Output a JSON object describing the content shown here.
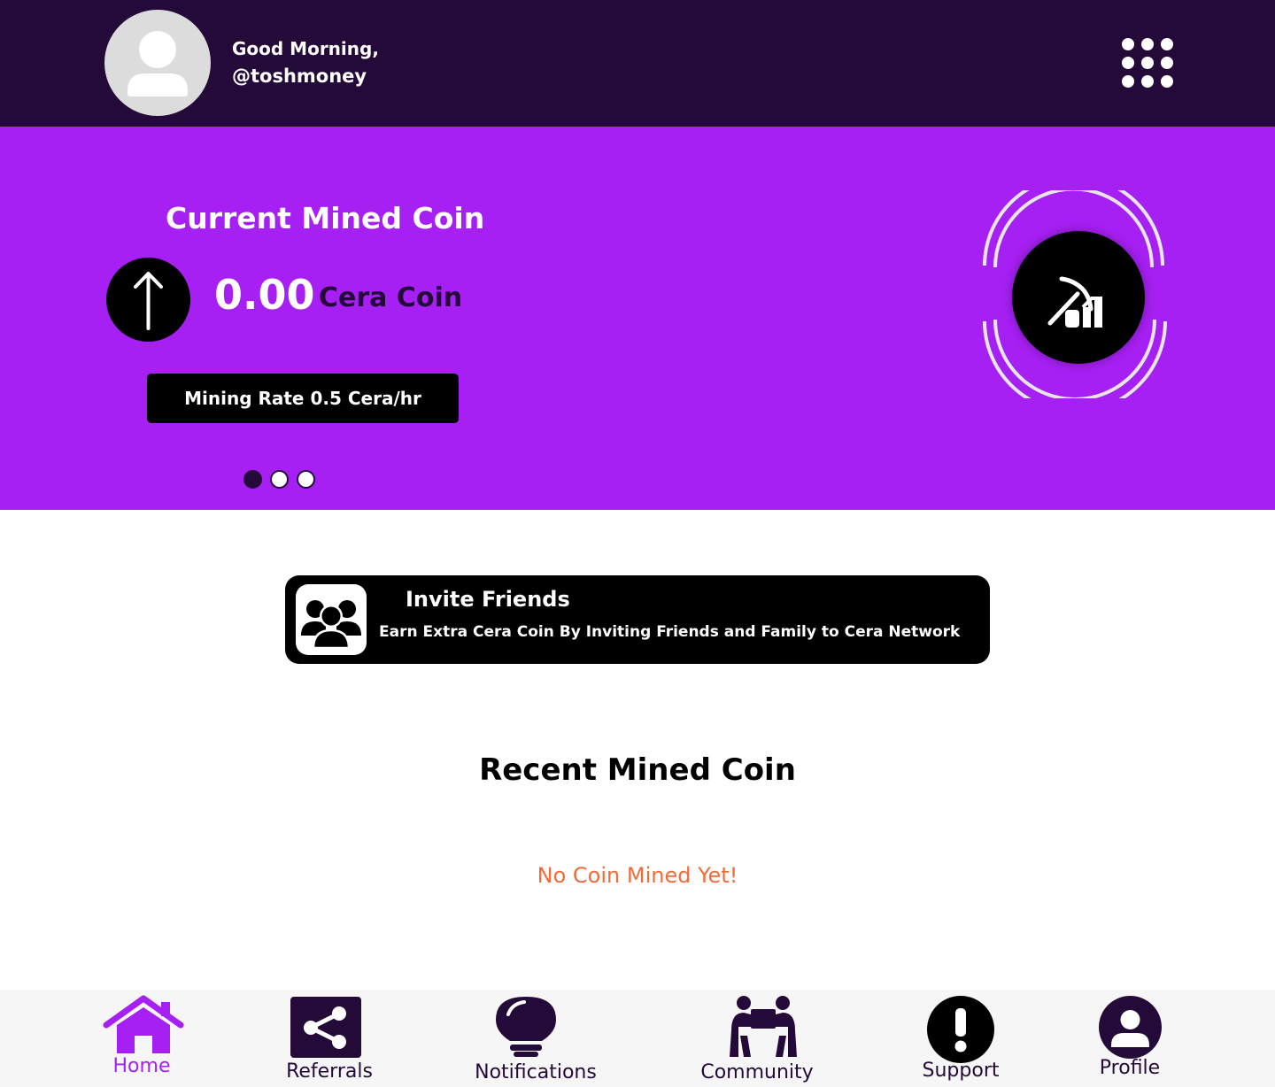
{
  "header": {
    "greeting": "Good Morning,",
    "username": "@toshmoney"
  },
  "banner": {
    "title": "Current Mined Coin",
    "amount": "0.00",
    "currency": "Cera Coin",
    "mining_rate": "Mining Rate 0.5 Cera/hr",
    "carousel_active_index": 0,
    "carousel_count": 3
  },
  "invite": {
    "title": "Invite Friends",
    "subtitle": "Earn Extra Cera Coin By Inviting Friends and Family to Cera Network"
  },
  "recent": {
    "title": "Recent Mined Coin",
    "empty_message": "No Coin Mined Yet!"
  },
  "nav": {
    "items": [
      {
        "label": "Home",
        "icon": "home-icon",
        "active": true
      },
      {
        "label": "Referrals",
        "icon": "share-icon",
        "active": false
      },
      {
        "label": "Notifications",
        "icon": "lightbulb-icon",
        "active": false
      },
      {
        "label": "Community",
        "icon": "community-icon",
        "active": false
      },
      {
        "label": "Support",
        "icon": "exclamation-icon",
        "active": false
      },
      {
        "label": "Profile",
        "icon": "profile-icon",
        "active": false
      }
    ]
  },
  "colors": {
    "header_bg": "#240a38",
    "banner_bg": "#a61ff3",
    "accent": "#a61ff3",
    "empty_text": "#f26b3a"
  }
}
